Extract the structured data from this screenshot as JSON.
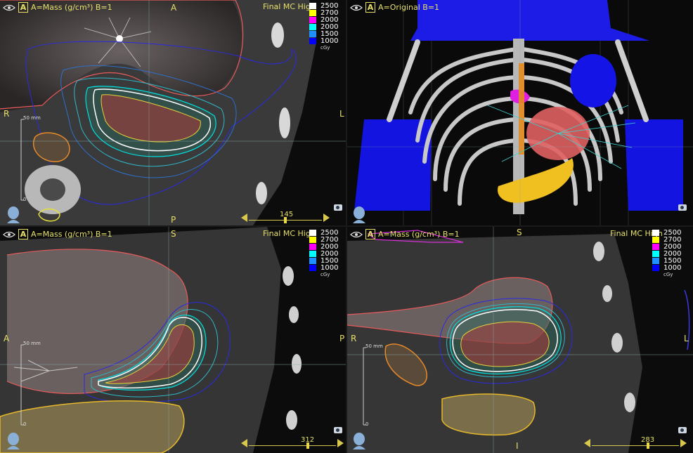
{
  "panels": {
    "axial": {
      "header": "A=Mass (g/cm³) B=1",
      "dose_title": "Final MC High",
      "orient": {
        "top": "A",
        "bottom": "P",
        "left": "R",
        "right": "L"
      },
      "scale_label": "50 mm",
      "scale_zero": "0",
      "slice": "145"
    },
    "render3d": {
      "header": "A=Original B=1"
    },
    "sagittal": {
      "header": "A=Mass (g/cm³) B=1",
      "dose_title": "Final MC High",
      "orient": {
        "top": "S",
        "left": "A",
        "right": "P"
      },
      "scale_label": "50 mm",
      "scale_zero": "0",
      "slice": "312"
    },
    "coronal": {
      "header": "A=Mass (g/cm³) B=1",
      "dose_title": "Final MC High",
      "orient": {
        "top": "S",
        "bottom": "I",
        "left": "R",
        "right": "L"
      },
      "scale_label": "50 mm",
      "scale_zero": "0",
      "slice": "283"
    }
  },
  "dose_legend": {
    "levels": [
      {
        "value": "2500",
        "color": "#ffffff"
      },
      {
        "value": "2700",
        "color": "#ffff00"
      },
      {
        "value": "2000",
        "color": "#ff00ff"
      },
      {
        "value": "2000",
        "color": "#00ffff"
      },
      {
        "value": "1500",
        "color": "#1e90ff"
      },
      {
        "value": "1000",
        "color": "#0000ff"
      }
    ],
    "unit": "cGy"
  },
  "icons": {
    "visibility": "eye-icon",
    "orientation": "head-icon",
    "snapshot": "camera-icon"
  }
}
